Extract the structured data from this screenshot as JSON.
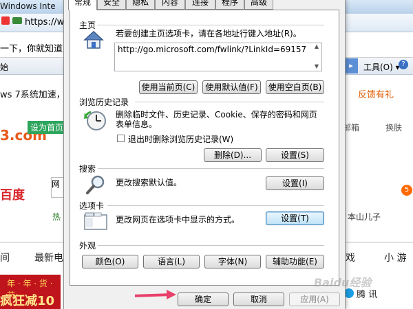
{
  "background": {
    "window_title": "Windows Inte",
    "address_text": "https://w",
    "search_text": "一下，你就知道",
    "toolbar_text": "始",
    "tools_menu": "工具(O) ▾",
    "help_icon_char": "?",
    "nav_left_arrow": "◂",
    "nav_right_arrow": "▸",
    "headline_text": "ws 7系统加速，",
    "feedback_text": "反馈有礼",
    "logo_fragment": "3.com",
    "homepage_link": "设为首页",
    "mail_text": "邮箱",
    "skin_text": "换肤",
    "baidu_logo_text": "百度",
    "search_box_text": "网",
    "badge_text": "5",
    "hot_text": "热",
    "link_son": "本山儿子",
    "nav_item_1": "间",
    "nav_item_2": "最新电",
    "nav_item_3": "戏",
    "nav_item_4": "小 游",
    "banner_text_1": "年 · 年 · 货 · 节",
    "banner_text_2": "疯狂减10",
    "tencent_text": "腾 讯"
  },
  "dialog": {
    "tabs": [
      {
        "label": "常规",
        "active": true
      },
      {
        "label": "安全",
        "active": false
      },
      {
        "label": "隐私",
        "active": false
      },
      {
        "label": "内容",
        "active": false
      },
      {
        "label": "连接",
        "active": false
      },
      {
        "label": "程序",
        "active": false
      },
      {
        "label": "高级",
        "active": false
      }
    ],
    "homepage": {
      "title": "主页",
      "description": "若要创建主页选项卡，请在各地址行键入地址",
      "description_key": "(R)。",
      "url": "http://go.microsoft.com/fwlink/?LinkId=69157",
      "use_current": "使用当前页(C)",
      "use_default": "使用默认值(F)",
      "use_blank": "使用空白页(B)"
    },
    "history": {
      "title": "浏览历史记录",
      "description_line1": "删除临时文件、历史记录、Cookie、保存的密码和网页",
      "description_line2": "表单信息。",
      "exit_checkbox_label": "退出时删除浏览历史记录(W)",
      "exit_checkbox_checked": false,
      "delete_button": "删除(D)...",
      "settings_button": "设置(S)"
    },
    "search": {
      "title": "搜索",
      "description": "更改搜索默认值。",
      "settings_button": "设置(I)"
    },
    "tabs_section": {
      "title": "选项卡",
      "description": "更改网页在选项卡中显示的方式。",
      "settings_button": "设置(T)"
    },
    "appearance": {
      "title": "外观",
      "colors": "颜色(O)",
      "languages": "语言(L)",
      "fonts": "字体(N)",
      "accessibility": "辅助功能(E)"
    },
    "footer": {
      "ok": "确定",
      "cancel": "取消",
      "apply": "应用(A)"
    }
  },
  "watermark_text": "Baidu经验",
  "colors": {
    "annotation_arrow": "#e8406a",
    "focus_blue": "#3c7fb1",
    "feedback_orange": "#e15b00",
    "baidu_red": "#d8242a"
  }
}
